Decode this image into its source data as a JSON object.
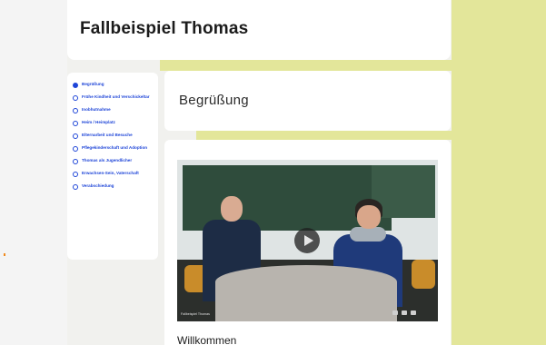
{
  "title": "Fallbeispiel Thomas",
  "nav": {
    "items": [
      {
        "label": "Begrüßung",
        "active": true
      },
      {
        "label": "Frühe Kindheit und Verschickeltar",
        "active": false
      },
      {
        "label": "Inobhutnahme",
        "active": false
      },
      {
        "label": "Heim / Heimplatz",
        "active": false
      },
      {
        "label": "Elternarbeit und Besuche",
        "active": false
      },
      {
        "label": "Pflegekinderschaft und Adoption",
        "active": false
      },
      {
        "label": "Thomas als Jugendlicher",
        "active": false
      },
      {
        "label": "Erwachsen-Sein, Vaterschaft",
        "active": false
      },
      {
        "label": "Verabschiedung",
        "active": false
      }
    ]
  },
  "section": {
    "heading": "Begrüßung"
  },
  "video": {
    "caption": "Fallbeispiel Thomas"
  },
  "content": {
    "subheading": "Willkommen"
  },
  "colors": {
    "accent_blue": "#1e45d8",
    "accent_green": "#e3e69a"
  }
}
